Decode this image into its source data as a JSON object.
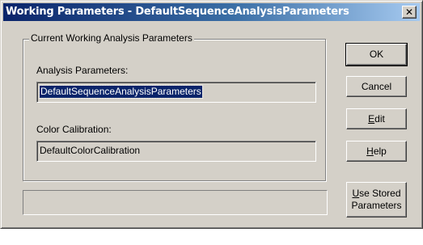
{
  "window": {
    "title": "Working Parameters - DefaultSequenceAnalysisParameters",
    "close_glyph": "✕"
  },
  "group": {
    "title": "Current Working Analysis Parameters",
    "analysis_label": "Analysis Parameters:",
    "analysis_value": "DefaultSequenceAnalysisParameters",
    "color_label": "Color Calibration:",
    "color_value": "DefaultColorCalibration"
  },
  "buttons": {
    "ok": "OK",
    "cancel": "Cancel",
    "edit_mnemonic": "E",
    "edit_rest": "dit",
    "help_mnemonic": "H",
    "help_rest": "elp",
    "use_stored_mnemonic": "U",
    "use_stored_line1_rest": "se Stored",
    "use_stored_line2": "Parameters"
  },
  "status": {
    "text": ""
  },
  "icons": {
    "close": "close-icon"
  }
}
